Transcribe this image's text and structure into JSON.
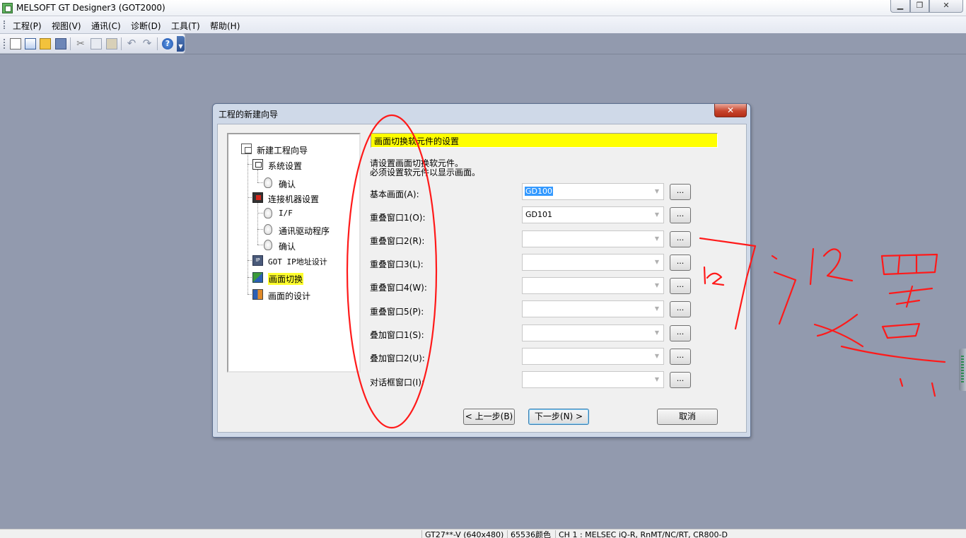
{
  "window": {
    "title": "MELSOFT GT Designer3 (GOT2000)",
    "minimize": "▁",
    "maximize": "❐",
    "close": "✕"
  },
  "menu": {
    "items": [
      "工程(P)",
      "视图(V)",
      "通讯(C)",
      "诊断(D)",
      "工具(T)",
      "帮助(H)"
    ]
  },
  "toolbar": {
    "cut_glyph": "✂",
    "undo_glyph": "↶",
    "redo_glyph": "↷",
    "help_glyph": "?"
  },
  "dialog": {
    "title": "工程的新建向导",
    "close": "✕",
    "tree": {
      "root": "新建工程向导",
      "system": "系统设置",
      "confirm1": "确认",
      "device": "连接机器设置",
      "interface": "I/F",
      "driver": "通讯驱动程序",
      "confirm2": "确认",
      "ip": "GOT IP地址设计",
      "switch": "画面切换",
      "design": "画面的设计"
    },
    "section_title": "画面切换软元件的设置",
    "desc_line1": "请设置画面切换软元件。",
    "desc_line2": "必须设置软元件以显示画面。",
    "fields": [
      {
        "label": "基本画面(A):",
        "value": "GD100"
      },
      {
        "label": "重叠窗口1(O):",
        "value": "GD101"
      },
      {
        "label": "重叠窗口2(R):",
        "value": ""
      },
      {
        "label": "重叠窗口3(L):",
        "value": ""
      },
      {
        "label": "重叠窗口4(W):",
        "value": ""
      },
      {
        "label": "重叠窗口5(P):",
        "value": ""
      },
      {
        "label": "叠加窗口1(S):",
        "value": ""
      },
      {
        "label": "叠加窗口2(U):",
        "value": ""
      },
      {
        "label": "对话框窗口(I):",
        "value": ""
      }
    ],
    "browse_label": "...",
    "combo_arrow": "▼",
    "buttons": {
      "prev": "< 上一步(B)",
      "next": "下一步(N) >",
      "cancel": "取消"
    }
  },
  "statusbar": {
    "model": "GT27**-V (640x480)",
    "colors": "65536颜色",
    "channel": "CH 1 : MELSEC iQ-R, RnMT/NC/RT, CR800-D"
  },
  "colors": {
    "workspace": "#929aae",
    "highlight_yellow": "#ffff00",
    "annotation_red": "#ff1a1a"
  }
}
